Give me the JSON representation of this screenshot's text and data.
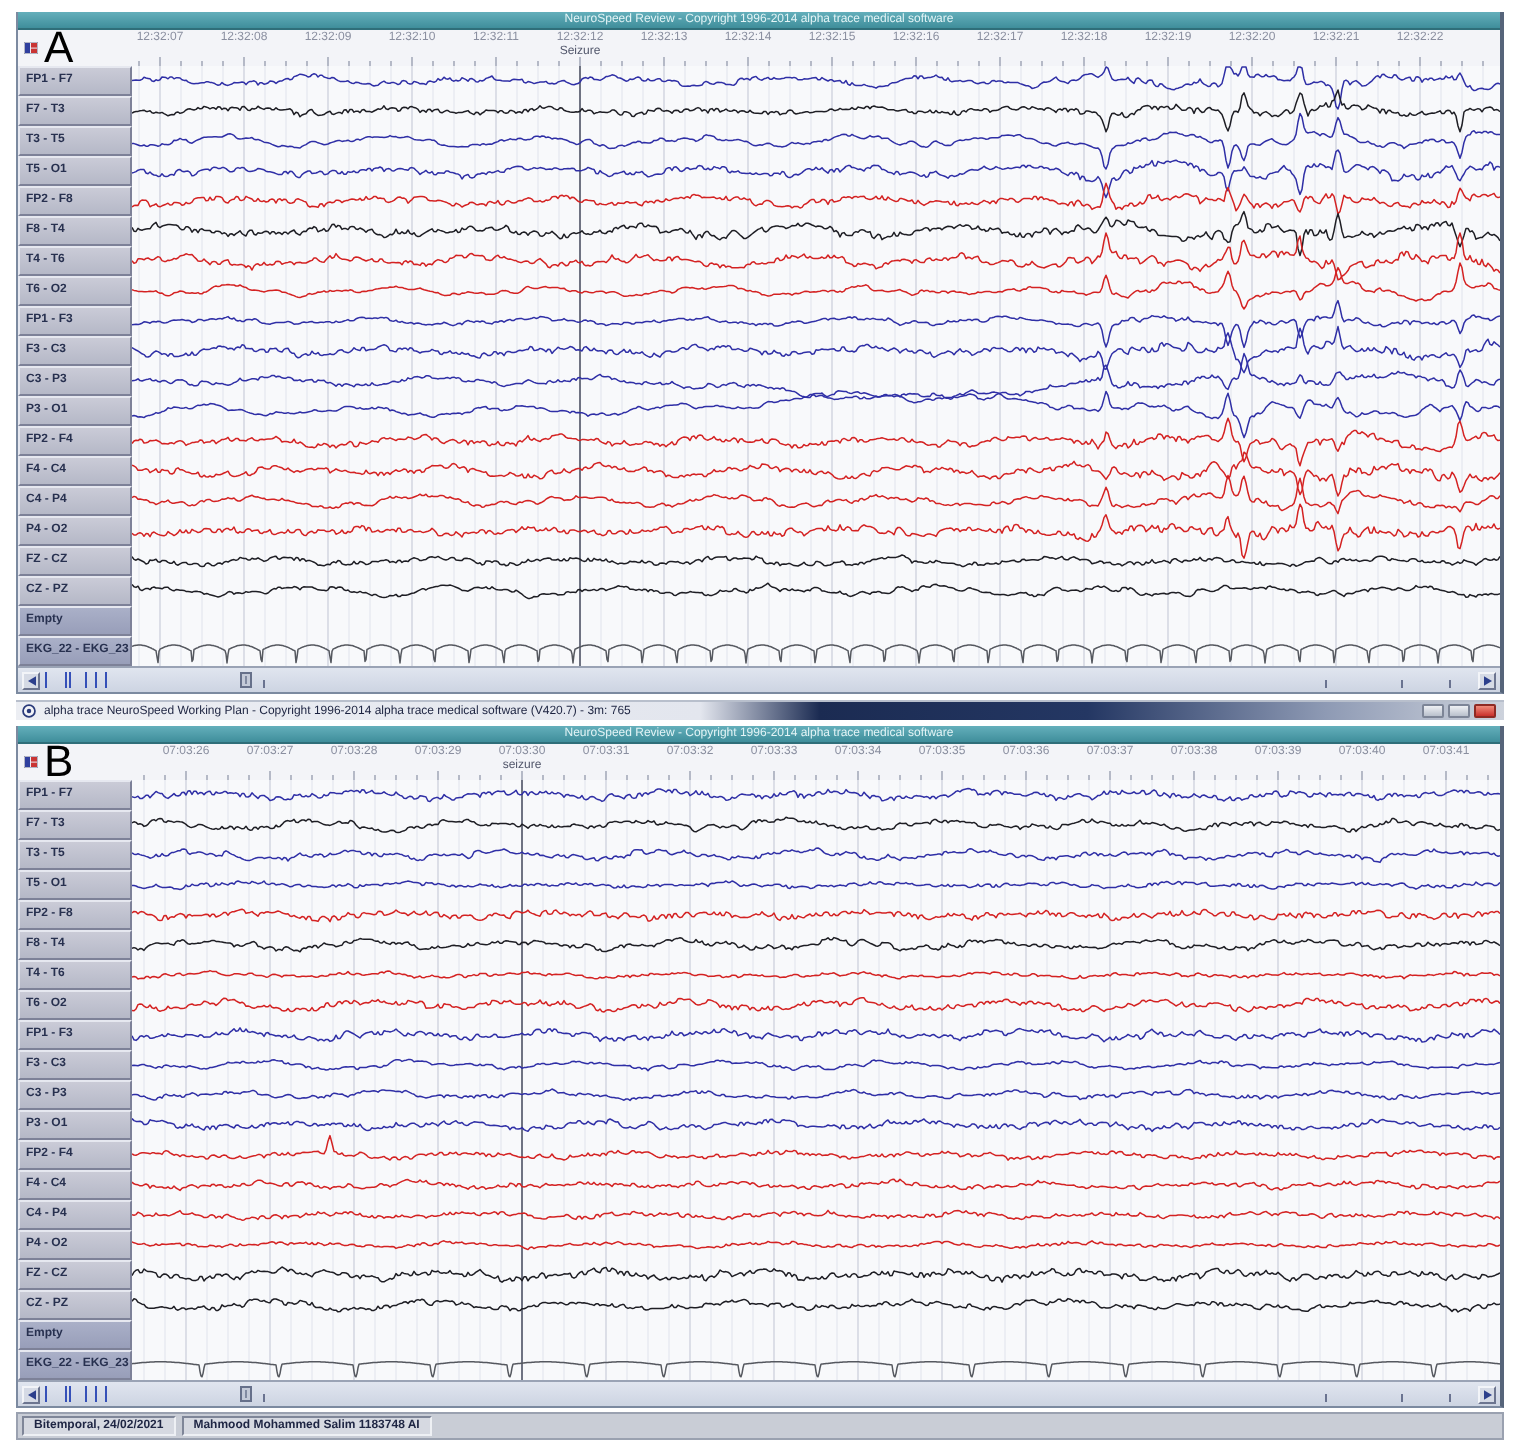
{
  "top_review": {
    "title": "NeuroSpeed Review - Copyright 1996-2014 alpha trace medical software",
    "letter": "A",
    "times": [
      {
        "label": "12:32:07"
      },
      {
        "label": "12:32:08"
      },
      {
        "label": "12:32:09"
      },
      {
        "label": "12:32:10"
      },
      {
        "label": "12:32:11"
      },
      {
        "label": "12:32:12",
        "marker": "Seizure"
      },
      {
        "label": "12:32:13"
      },
      {
        "label": "12:32:14"
      },
      {
        "label": "12:32:15"
      },
      {
        "label": "12:32:16"
      },
      {
        "label": "12:32:17"
      },
      {
        "label": "12:32:18"
      },
      {
        "label": "12:32:19"
      },
      {
        "label": "12:32:20"
      },
      {
        "label": "12:32:21"
      },
      {
        "label": "12:32:22"
      }
    ],
    "channels": [
      {
        "name": "FP1 - F7",
        "kind": "eeg",
        "color": "#2f2fa6"
      },
      {
        "name": "F7 - T3",
        "kind": "eeg",
        "color": "#1e1e24"
      },
      {
        "name": "T3 - T5",
        "kind": "eeg",
        "color": "#2f2fa6"
      },
      {
        "name": "T5 - O1",
        "kind": "eeg",
        "color": "#2f2fa6"
      },
      {
        "name": "FP2 - F8",
        "kind": "eeg",
        "color": "#d42222"
      },
      {
        "name": "F8 - T4",
        "kind": "eeg",
        "color": "#1e1e24"
      },
      {
        "name": "T4 - T6",
        "kind": "eeg",
        "color": "#d42222"
      },
      {
        "name": "T6 - O2",
        "kind": "eeg",
        "color": "#d42222"
      },
      {
        "name": "FP1 - F3",
        "kind": "eeg",
        "color": "#2f2fa6"
      },
      {
        "name": "F3 - C3",
        "kind": "eeg",
        "color": "#2f2fa6"
      },
      {
        "name": "C3 - P3",
        "kind": "eeg",
        "color": "#2f2fa6"
      },
      {
        "name": "P3 - O1",
        "kind": "eeg",
        "color": "#2f2fa6"
      },
      {
        "name": "FP2 - F4",
        "kind": "eeg",
        "color": "#d42222"
      },
      {
        "name": "F4 - C4",
        "kind": "eeg",
        "color": "#d42222"
      },
      {
        "name": "C4 - P4",
        "kind": "eeg",
        "color": "#d42222"
      },
      {
        "name": "P4 - O2",
        "kind": "eeg",
        "color": "#d42222"
      },
      {
        "name": "FZ - CZ",
        "kind": "eeg",
        "color": "#1e1e24"
      },
      {
        "name": "CZ - PZ",
        "kind": "eeg",
        "color": "#1e1e24"
      },
      {
        "name": "Empty",
        "kind": "empty"
      },
      {
        "name": "EKG_22 - EKG_23",
        "kind": "ekg",
        "color": "#55585f"
      }
    ]
  },
  "working_plan_bar": {
    "title": "alpha trace NeuroSpeed Working Plan - Copyright 1996-2014 alpha trace medical software (V420.7) - 3m: 765"
  },
  "bottom_review": {
    "title": "NeuroSpeed Review - Copyright 1996-2014 alpha trace medical software",
    "letter": "B",
    "times": [
      {
        "label": "07:03:26"
      },
      {
        "label": "07:03:27"
      },
      {
        "label": "07:03:28"
      },
      {
        "label": "07:03:29"
      },
      {
        "label": "07:03:30",
        "marker": "seizure"
      },
      {
        "label": "07:03:31"
      },
      {
        "label": "07:03:32"
      },
      {
        "label": "07:03:33"
      },
      {
        "label": "07:03:34"
      },
      {
        "label": "07:03:35"
      },
      {
        "label": "07:03:36"
      },
      {
        "label": "07:03:37"
      },
      {
        "label": "07:03:38"
      },
      {
        "label": "07:03:39"
      },
      {
        "label": "07:03:40"
      },
      {
        "label": "07:03:41"
      }
    ],
    "channels": [
      {
        "name": "FP1 - F7",
        "kind": "eeg",
        "color": "#2f2fa6"
      },
      {
        "name": "F7 - T3",
        "kind": "eeg",
        "color": "#1e1e24"
      },
      {
        "name": "T3 - T5",
        "kind": "eeg",
        "color": "#2f2fa6"
      },
      {
        "name": "T5 - O1",
        "kind": "eeg",
        "color": "#2f2fa6"
      },
      {
        "name": "FP2 - F8",
        "kind": "eeg",
        "color": "#d42222"
      },
      {
        "name": "F8 - T4",
        "kind": "eeg",
        "color": "#1e1e24"
      },
      {
        "name": "T4 - T6",
        "kind": "eeg",
        "color": "#d42222"
      },
      {
        "name": "T6 - O2",
        "kind": "eeg",
        "color": "#d42222"
      },
      {
        "name": "FP1 - F3",
        "kind": "eeg",
        "color": "#2f2fa6"
      },
      {
        "name": "F3 - C3",
        "kind": "eeg",
        "color": "#2f2fa6"
      },
      {
        "name": "C3 - P3",
        "kind": "eeg",
        "color": "#2f2fa6"
      },
      {
        "name": "P3 - O1",
        "kind": "eeg",
        "color": "#2f2fa6"
      },
      {
        "name": "FP2 - F4",
        "kind": "eeg",
        "color": "#d42222"
      },
      {
        "name": "F4 - C4",
        "kind": "eeg",
        "color": "#d42222"
      },
      {
        "name": "C4 - P4",
        "kind": "eeg",
        "color": "#d42222"
      },
      {
        "name": "P4 - O2",
        "kind": "eeg",
        "color": "#d42222"
      },
      {
        "name": "FZ - CZ",
        "kind": "eeg",
        "color": "#1e1e24"
      },
      {
        "name": "CZ - PZ",
        "kind": "eeg",
        "color": "#1e1e24"
      },
      {
        "name": "Empty",
        "kind": "empty"
      },
      {
        "name": "EKG_22 - EKG_23",
        "kind": "ekg",
        "color": "#55585f"
      }
    ]
  },
  "status_bar": {
    "fields": [
      "Bitemporal, 24/02/2021",
      "Mahmood Mohammed Salim 1183748 AI"
    ]
  }
}
